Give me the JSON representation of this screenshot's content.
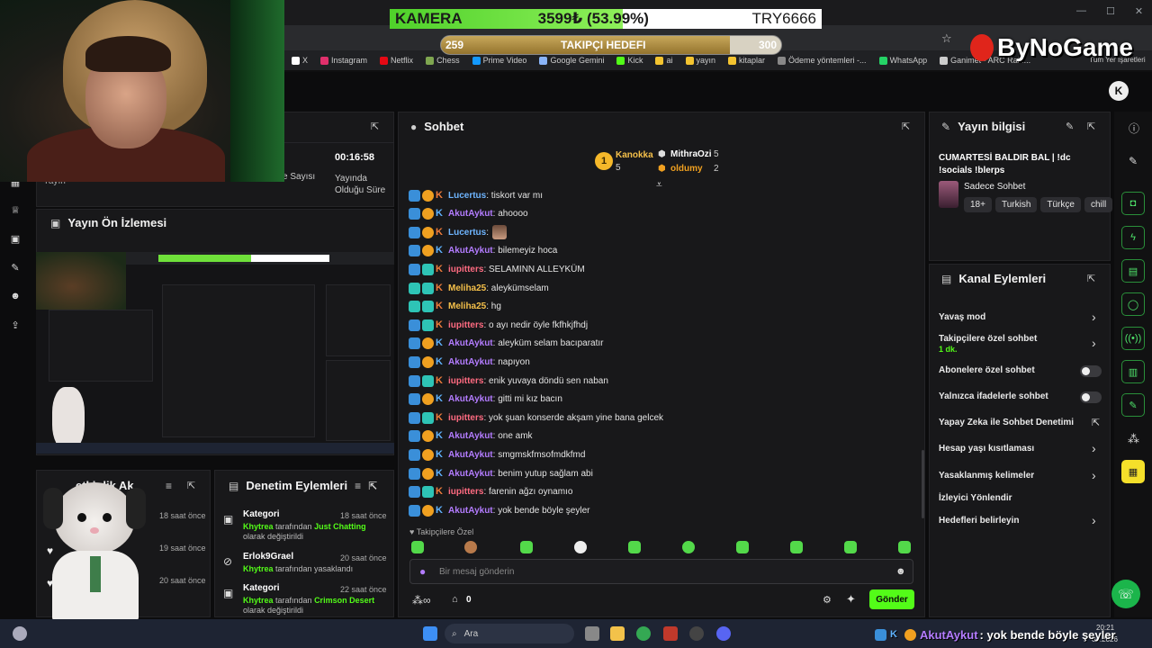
{
  "overlay": {
    "kamera_label": "KAMERA",
    "kamera_value": "3599₺ (53.99%)",
    "kamera_progress": 0.5399,
    "kamera_currency": "TRY6666",
    "goal_start": "259",
    "goal_title": "TAKIPÇI HEDEFI",
    "goal_end": "300",
    "brand": "ByNoGame"
  },
  "bookmarks": [
    {
      "label": "X",
      "color": "#ffffff"
    },
    {
      "label": "Instagram",
      "color": "#e1306c"
    },
    {
      "label": "Netflix",
      "color": "#e50914"
    },
    {
      "label": "Chess",
      "color": "#7fa650"
    },
    {
      "label": "Prime Video",
      "color": "#1399ff"
    },
    {
      "label": "Google Gemini",
      "color": "#8ab4f8"
    },
    {
      "label": "Kick",
      "color": "#53fc18"
    },
    {
      "label": "ai",
      "color": "#f4c430"
    },
    {
      "label": "yayın",
      "color": "#f4c430"
    },
    {
      "label": "kitaplar",
      "color": "#f4c430"
    },
    {
      "label": "Ödeme yöntemleri -...",
      "color": "#888888"
    },
    {
      "label": "WhatsApp",
      "color": "#25d366"
    },
    {
      "label": "Ganimet - ARC Raid...",
      "color": "#cccccc"
    }
  ],
  "bookmarks_overflow": "Tüm Yer İşaretleri",
  "stats": {
    "partial_label_1": "Yayın",
    "viewer_count_label": "e Sayısı",
    "duration_value": "00:16:58",
    "duration_label": "Yayında Olduğu Süre"
  },
  "preview": {
    "title": "Yayın Ön İzlemesi"
  },
  "activity": {
    "title": "etkinlik Ak",
    "times": [
      "18 saat önce",
      "19 saat önce",
      "20 saat önce"
    ]
  },
  "moderation": {
    "title": "Denetim Eylemleri",
    "items": [
      {
        "title": "Kategori",
        "time": "18 saat önce",
        "actor": "Khytrea",
        "text": " tarafından ",
        "target": "Just Chatting",
        "suffix": " olarak değiştirildi"
      },
      {
        "title": "Erlok9Grael",
        "time": "20 saat önce",
        "actor": "Khytrea",
        "text": " tarafından yasaklandı",
        "target": "",
        "suffix": ""
      },
      {
        "title": "Kategori",
        "time": "22 saat önce",
        "actor": "Khytrea",
        "text": " tarafından ",
        "target": "Crimson Desert",
        "suffix": " olarak değiştirildi"
      }
    ]
  },
  "chat": {
    "title": "Sohbet",
    "leaderboard": [
      {
        "rank": "1",
        "name": "Kanokka",
        "count": "5"
      },
      {
        "name": "MithraOzi",
        "count": "5"
      },
      {
        "name": "oldumy",
        "count": "2"
      }
    ],
    "messages": [
      {
        "user": "Lucertus",
        "text": ": tiskort var mı",
        "color": "u-blue"
      },
      {
        "user": "AkutAykut",
        "text": ": ahoooo",
        "color": "u-purple"
      },
      {
        "user": "Lucertus",
        "text": ":",
        "color": "u-blue"
      },
      {
        "user": "AkutAykut",
        "text": ": bilemeyiz hoca",
        "color": "u-purple"
      },
      {
        "user": "iupitters",
        "text": ": SELAMINN ALLEYKÜM",
        "color": "u-red"
      },
      {
        "user": "Meliha25",
        "text": ": aleykümselam",
        "color": "u-yellow"
      },
      {
        "user": "Meliha25",
        "text": ": hg",
        "color": "u-yellow"
      },
      {
        "user": "iupitters",
        "text": ": o ayı nedir öyle fkfhkjfhdj",
        "color": "u-red"
      },
      {
        "user": "AkutAykut",
        "text": ": aleyküm selam bacıparatır",
        "color": "u-purple"
      },
      {
        "user": "AkutAykut",
        "text": ": napıyon",
        "color": "u-purple"
      },
      {
        "user": "iupitters",
        "text": ": enik yuvaya döndü sen naban",
        "color": "u-red"
      },
      {
        "user": "AkutAykut",
        "text": ": gitti mi kız bacın",
        "color": "u-purple"
      },
      {
        "user": "iupitters",
        "text": ": yok şuan konserde akşam yine bana gelcek",
        "color": "u-red"
      },
      {
        "user": "AkutAykut",
        "text": ": one amk",
        "color": "u-purple"
      },
      {
        "user": "AkutAykut",
        "text": ": smgmskfmsofmdkfmd",
        "color": "u-purple"
      },
      {
        "user": "AkutAykut",
        "text": ": benim yutup sağlam abi",
        "color": "u-purple"
      },
      {
        "user": "iupitters",
        "text": ": farenin ağzı oynamıo",
        "color": "u-red"
      },
      {
        "user": "AkutAykut",
        "text": ": yok bende böyle şeyler",
        "color": "u-purple"
      }
    ],
    "followers_only": "Takipçilere Özel",
    "input_placeholder": "Bir mesaj gönderin",
    "points": "0",
    "send_label": "Gönder"
  },
  "stream_info": {
    "title": "Yayın bilgisi",
    "stream_title": "CUMARTESİ BALDIR BAL | !dc !socials !blerps",
    "category": "Sadece Sohbet",
    "tags": [
      "18+",
      "Turkish",
      "Türkçe",
      "chill"
    ]
  },
  "channel_actions": {
    "title": "Kanal Eylemleri",
    "items": [
      {
        "label": "Yavaş mod",
        "sub": "",
        "control": "chevron"
      },
      {
        "label": "Takipçilere özel sohbet",
        "sub": "1 dk.",
        "control": "chevron"
      },
      {
        "label": "Abonelere özel sohbet",
        "sub": "",
        "control": "toggle"
      },
      {
        "label": "Yalnızca ifadelerle sohbet",
        "sub": "",
        "control": "toggle"
      },
      {
        "label": "Yapay Zeka ile Sohbet Denetimi",
        "sub": "",
        "control": "external"
      },
      {
        "label": "Hesap yaşı kısıtlaması",
        "sub": "",
        "control": "chevron"
      },
      {
        "label": "Yasaklanmış kelimeler",
        "sub": "",
        "control": "chevron"
      },
      {
        "label": "İzleyici Yönlendir",
        "sub": "",
        "control": "none"
      },
      {
        "label": "Hedefleri belirleyin",
        "sub": "",
        "control": "chevron"
      }
    ]
  },
  "taskbar": {
    "search": "Ara",
    "time": "20:21",
    "date": "04.2026",
    "ticker_user": "AkutAykut",
    "ticker_text": ": yok bende böyle şeyler"
  },
  "colors": {
    "accent": "#53fc18",
    "panel": "#18181a",
    "background": "#0c0c0d"
  }
}
